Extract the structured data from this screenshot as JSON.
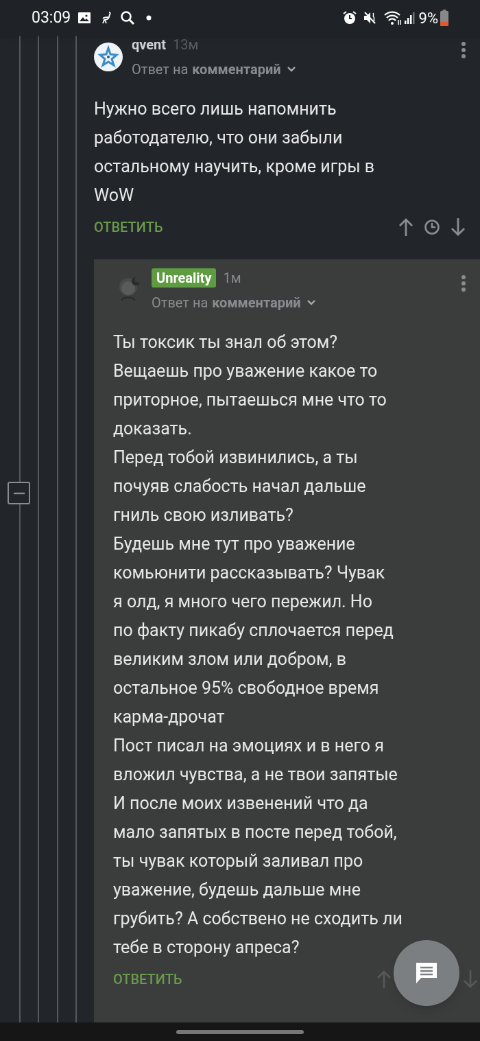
{
  "status_bar": {
    "time": "03:09",
    "battery_text": "9%"
  },
  "comments": [
    {
      "author": "qvent",
      "badge": false,
      "time": "13м",
      "reply_prefix": "Ответ на",
      "reply_target": "комментарий",
      "text": "Нужно всего лишь напомнить\nработодателю, что они забыли\nостальному научить, кроме игры в\nWoW",
      "reply_button": "ОТВЕТИТЬ",
      "collapse": false
    },
    {
      "author": "Unreality",
      "badge": true,
      "time": "1м",
      "reply_prefix": "Ответ на",
      "reply_target": "комментарий",
      "text": "Ты токсик ты знал об этом?\nВещаешь про уважение какое то\nприторное, пытаешься мне что то\nдоказать.\nПеред тобой извинились, а ты\nпочуяв слабость начал дальше\nгниль свою изливать?\nБудешь мне тут про уважение\nкомьюнити рассказывать? Чувак\nя олд, я много чего пережил. Но\nпо факту пикабу сплочается перед\nвеликим злом или добром, в\nостальное 95% свободное время\nкарма-дрочат\nПост писал на эмоциях и в него я\nвложил чувства, а не твои запятые\nИ после моих извенений что да\nмало запятых в посте перед тобой,\nты чувак который заливал про\nуважение, будешь дальше мне\nгрубить? А собствено не сходить ли\nтебе в сторону апреса?",
      "reply_button": "ОТВЕТИТЬ",
      "collapse": true
    }
  ]
}
